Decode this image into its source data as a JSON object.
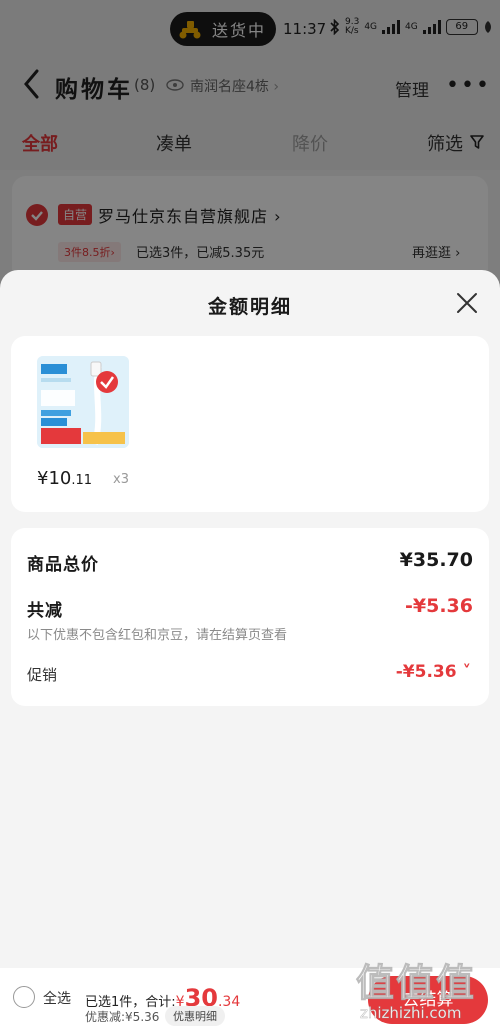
{
  "status_bar": {
    "delivery_label": "送货中",
    "time": "11:37",
    "net_speed": "9.3\nK/s",
    "signal_1": "4G",
    "signal_2": "4G",
    "battery": "69"
  },
  "header": {
    "title": "购物车",
    "count": "(8)",
    "location": "南润名座4栋",
    "manage": "管理",
    "more": "•••"
  },
  "tabs": [
    {
      "label": "全部"
    },
    {
      "label": "凑单"
    },
    {
      "label": "降价"
    },
    {
      "label": "筛选"
    }
  ],
  "store": {
    "badge": "自营",
    "name": "罗马仕京东自营旗舰店 ›",
    "promo_tag": "3件8.5折›",
    "promo_text": "已选3件，已减5.35元",
    "more": "再逛逛 ›"
  },
  "sheet": {
    "title": "金额明细",
    "product": {
      "price_int": "¥10",
      "price_dec": ".11",
      "qty": "x3",
      "image_text": {
        "watts": "100W",
        "fast": "超级快充",
        "amp": "6A大电流"
      }
    },
    "summary": {
      "total_label": "商品总价",
      "total_value": "¥35.70",
      "discount_label": "共减",
      "discount_value": "-¥5.36",
      "note": "以下优惠不包含红包和京豆，请在结算页查看",
      "promo_label": "促销",
      "promo_value": "-¥5.36 ˅"
    }
  },
  "bottom_bar": {
    "select_all": "全选",
    "selected_prefix": "已选1件，合计:",
    "currency": "¥",
    "total_int": "30",
    "total_dec": ".34",
    "discount": "优惠减:¥5.36",
    "detail_button": "优惠明细",
    "checkout": "去结算"
  },
  "watermark": {
    "main": "值值值",
    "sub": "zhizhizhi.com"
  },
  "colors": {
    "accent": "#e4393c",
    "background": "#f2f2f2"
  }
}
